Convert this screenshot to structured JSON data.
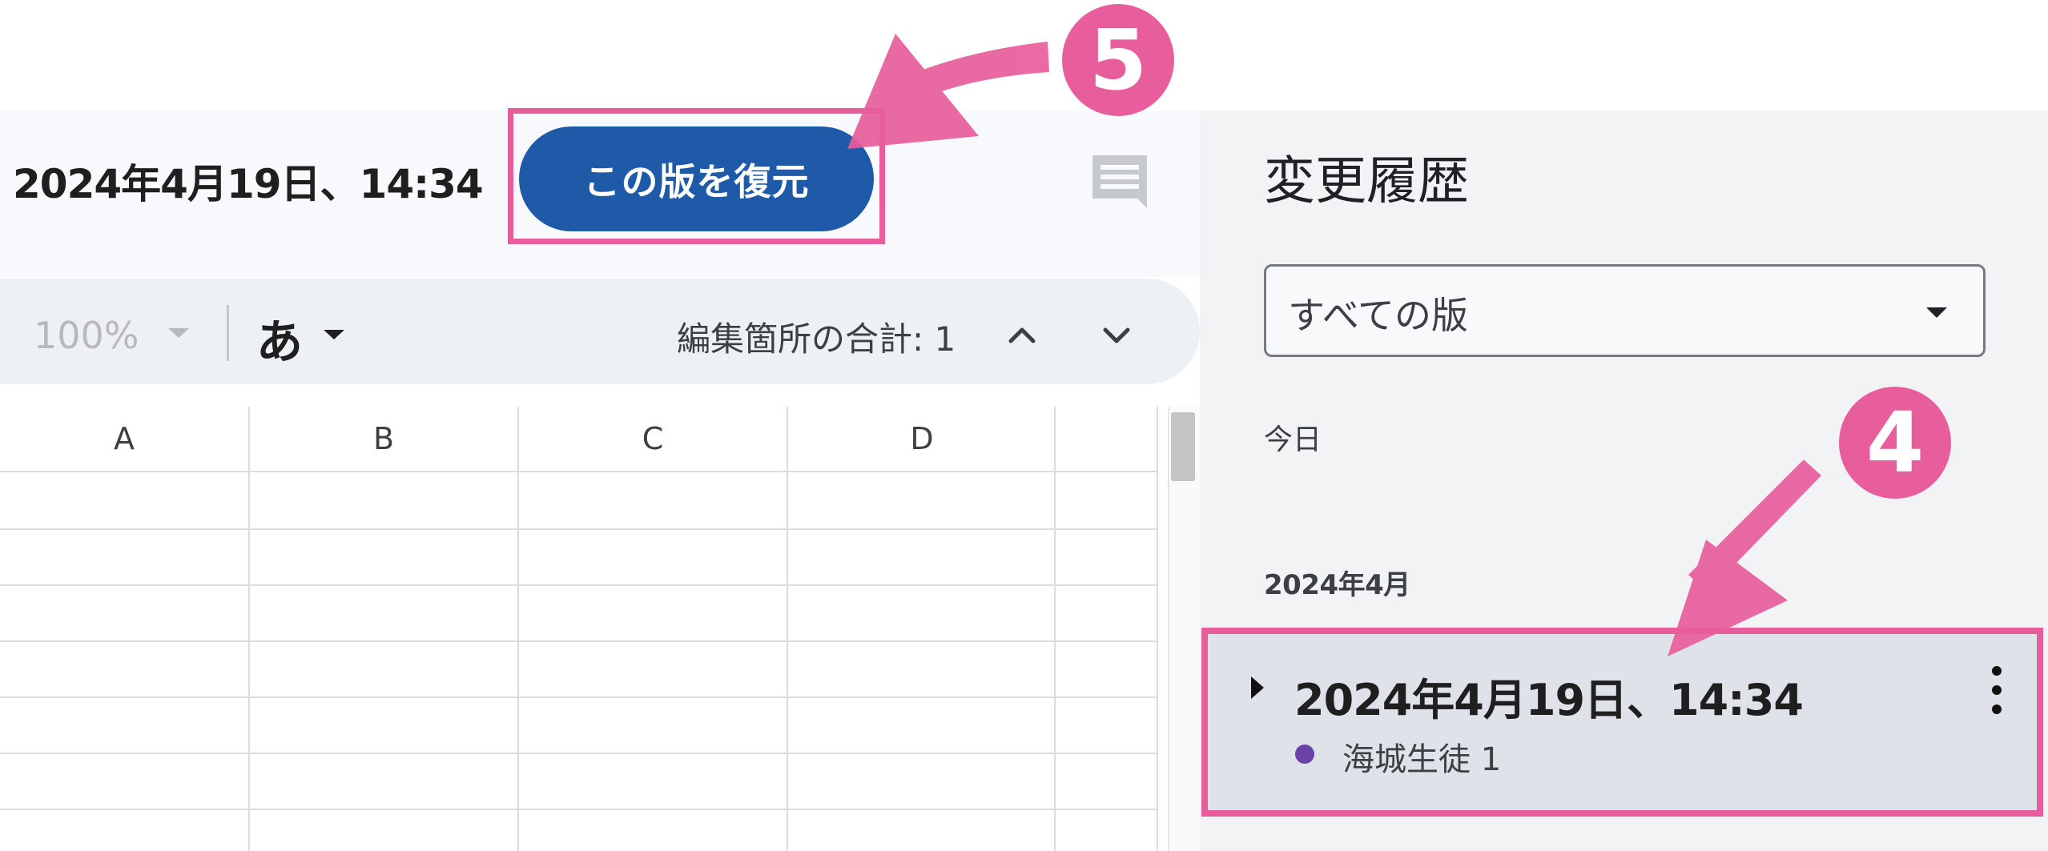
{
  "document": {
    "version_title": "2024年4月19日、14:34",
    "restore_button_label": "この版を復元"
  },
  "toolbar": {
    "zoom": "100%",
    "input_mode": "あ",
    "edit_count_label": "編集箇所の合計: 1"
  },
  "sheet": {
    "columns": [
      "A",
      "B",
      "C",
      "D"
    ]
  },
  "sidebar": {
    "title": "変更履歴",
    "filter": {
      "selected": "すべての版"
    },
    "groups": [
      {
        "label": "今日"
      },
      {
        "label": "2024年4月"
      }
    ],
    "versions": [
      {
        "title": "2024年4月19日、14:34",
        "author": "海城生徒 1",
        "author_color": "#6a42a8"
      }
    ]
  },
  "annotations": {
    "step5": "5",
    "step4": "4",
    "color": "#e85d9c"
  },
  "icons": {
    "comment": "comment-icon",
    "chevron_up": "chevron-up-icon",
    "chevron_down": "chevron-down-icon",
    "more": "more-vert-icon",
    "expand": "expand-arrow-icon"
  }
}
